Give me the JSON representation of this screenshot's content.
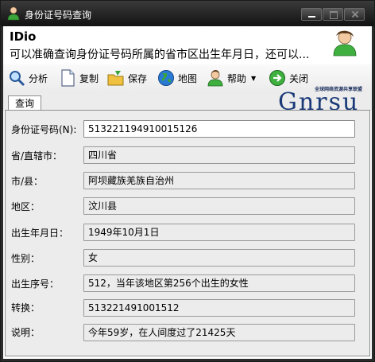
{
  "window": {
    "title": "身份证号码查询"
  },
  "header": {
    "app_name": "IDio",
    "description": "可以准确查询身份证号码所属的省市区出生年月日，还可以..."
  },
  "toolbar": {
    "items": [
      {
        "label": "分析",
        "icon": "magnifier-icon"
      },
      {
        "label": "复制",
        "icon": "document-icon"
      },
      {
        "label": "保存",
        "icon": "save-folder-icon"
      },
      {
        "label": "地图",
        "icon": "globe-icon"
      },
      {
        "label": "帮助",
        "icon": "user-help-icon"
      },
      {
        "label": "关闭",
        "icon": "close-arrow-icon"
      }
    ]
  },
  "tabs": [
    {
      "label": "查询"
    }
  ],
  "logo": {
    "text": "Gnrsu",
    "tagline": "全球网络资源共享联盟"
  },
  "form": {
    "id_label": "身份证号码(N):",
    "id_value": "513221194910015126",
    "rows": [
      {
        "label": "省/直辖市：",
        "value": "四川省"
      },
      {
        "label": "市/县：",
        "value": "阿坝藏族羌族自治州"
      },
      {
        "label": "地区：",
        "value": "汶川县"
      },
      {
        "label": "出生年月日：",
        "value": "1949年10月1日"
      },
      {
        "label": "性别：",
        "value": "女"
      },
      {
        "label": "出生序号：",
        "value": "512，当年该地区第256个出生的女性"
      },
      {
        "label": "转换：",
        "value": "513221491001512"
      },
      {
        "label": "说明：",
        "value": "今年59岁，在人间度过了21425天"
      }
    ]
  },
  "colors": {
    "titlebar": "#121212",
    "panel": "#ececec",
    "logo": "#1a3a78"
  }
}
